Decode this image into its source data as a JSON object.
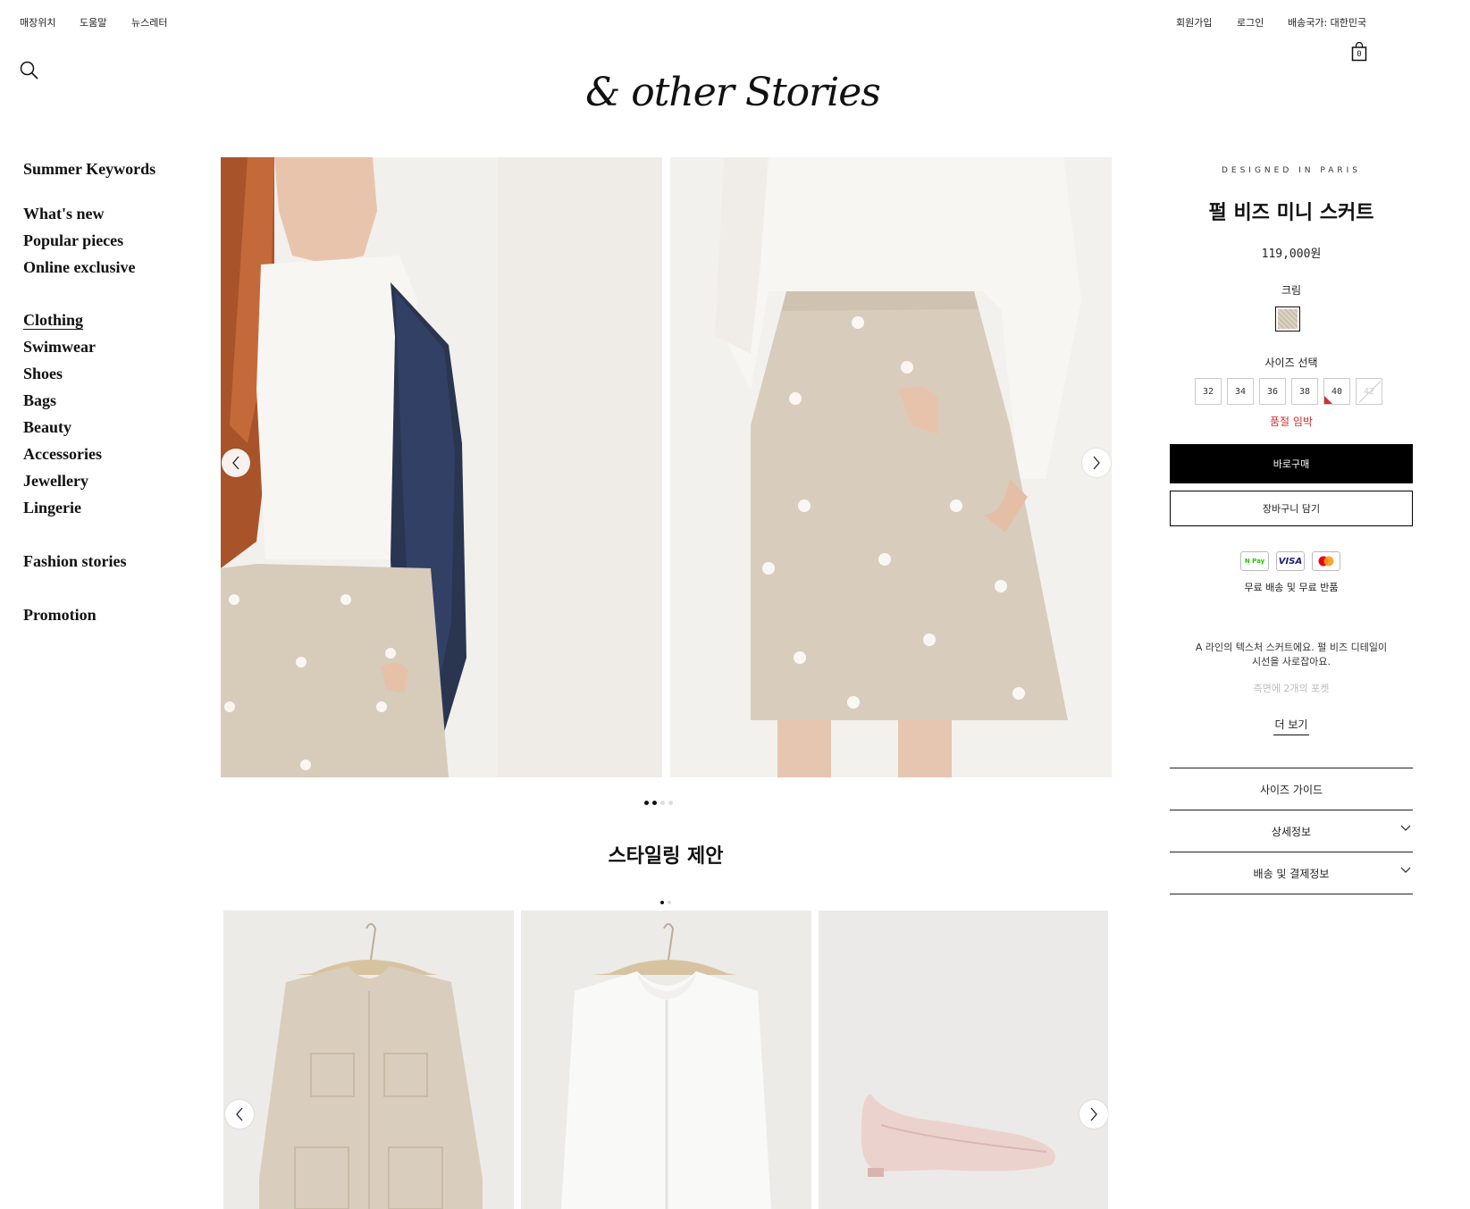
{
  "topbar": {
    "left_links": [
      "매장위치",
      "도움말",
      "뉴스레터"
    ],
    "signup": "회원가입",
    "login": "로그인",
    "country": "배송국가: 대한민국",
    "cart_count": "0"
  },
  "logo": "& other Stories",
  "nav": {
    "summer": "Summer Keywords",
    "whats_new": "What's new",
    "popular": "Popular pieces",
    "online": "Online exclusive",
    "clothing": "Clothing",
    "swimwear": "Swimwear",
    "shoes": "Shoes",
    "bags": "Bags",
    "beauty": "Beauty",
    "accessories": "Accessories",
    "jewellery": "Jewellery",
    "lingerie": "Lingerie",
    "fashion_stories": "Fashion stories",
    "promotion": "Promotion"
  },
  "styling": {
    "title": "스타일링 제안"
  },
  "product": {
    "designed_in": "DESIGNED IN PARIS",
    "name": "펄 비즈 미니 스커트",
    "price": "119,000원",
    "color_label": "크림",
    "size_label": "사이즈 선택",
    "sizes": [
      "32",
      "34",
      "36",
      "38",
      "40",
      "42"
    ],
    "sold_out_notice": "품절 임박",
    "buy_now": "바로구매",
    "add_to_cart": "장바구니 담기",
    "payment": {
      "npay": "N Pay",
      "visa": "VISA"
    },
    "free_shipping": "무료 배송 및 무료 반품",
    "description_line1": "A 라인의 텍스처 스커트에요. 펄 비즈 디테일이",
    "description_line2": "시선을 사로잡아요.",
    "description_faded": "측면에 2개의 포켓",
    "more": "더 보기",
    "accordion": [
      "사이즈 가이드",
      "상세정보",
      "배송 및 결제정보"
    ]
  }
}
